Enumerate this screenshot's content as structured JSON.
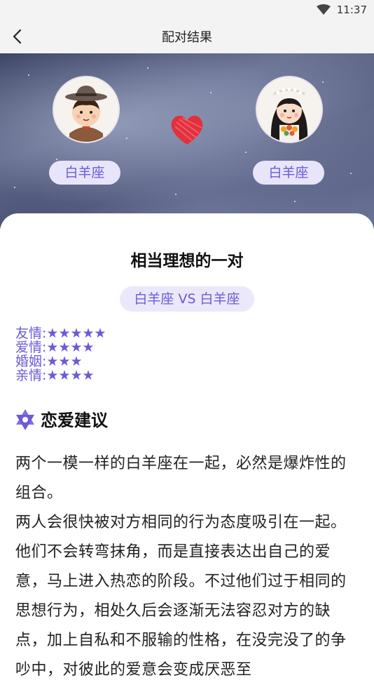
{
  "status_bar": {
    "time": "11:37",
    "wifi_icon": "wifi-icon"
  },
  "nav": {
    "title": "配对结果",
    "back_icon": "back-arrow-icon"
  },
  "pair": {
    "left_sign": "白羊座",
    "right_sign": "白羊座",
    "left_avatar_icon": "boy-avatar-icon",
    "right_avatar_icon": "girl-avatar-icon",
    "heart_icon": "heart-icon"
  },
  "result": {
    "title": "相当理想的一对",
    "vs_label": "白羊座 VS 白羊座"
  },
  "ratings": [
    {
      "label": "友情:",
      "stars": 5
    },
    {
      "label": "爱情:",
      "stars": 4
    },
    {
      "label": "婚姻:",
      "stars": 3
    },
    {
      "label": "亲情:",
      "stars": 4
    }
  ],
  "advice": {
    "heading": "恋爱建议",
    "heading_icon": "star-of-david-icon",
    "paragraphs": [
      "两个一模一样的白羊座在一起，必然是爆炸性的组合。",
      "两人会很快被对方相同的行为态度吸引在一起。他们不会转弯抹角，而是直接表达出自己的爱意，马上进入热恋的阶段。不过他们过于相同的思想行为，相处久后会逐渐无法容忍对方的缺点，加上自私和不服输的性格，在没完没了的争吵中，对彼此的爱意会变成厌恶至"
    ]
  },
  "colors": {
    "accent": "#6a5bd8",
    "pill_bg": "#e8e5fb"
  }
}
